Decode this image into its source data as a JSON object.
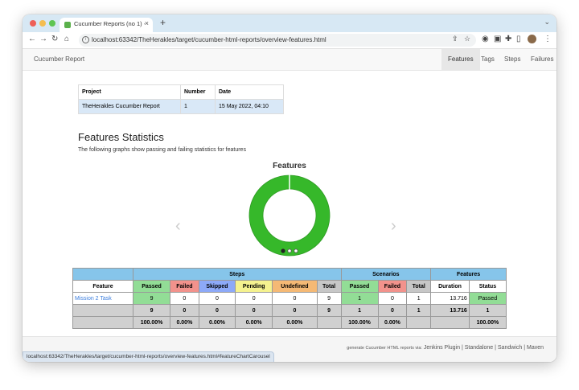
{
  "browser": {
    "tab_title": "Cucumber Reports (no 1) - Fea",
    "tab_close": "×",
    "new_tab": "+",
    "url": "localhost:63342/TheHerakles/target/cucumber-html-reports/overview-features.html",
    "status_url": "localhost:63342/TheHerakles/target/cucumber-html-reports/overview-features.html#featureChartCarousel"
  },
  "navbar": {
    "brand": "Cucumber Report",
    "links": [
      "Features",
      "Tags",
      "Steps",
      "Failures"
    ]
  },
  "report": {
    "headers": [
      "Project",
      "Number",
      "Date"
    ],
    "row": [
      "TheHerakles Cucumber Report",
      "1",
      "15 May 2022, 04:10"
    ]
  },
  "stats": {
    "title": "Features Statistics",
    "subtitle": "The following graphs show passing and failing statistics for features"
  },
  "chart_data": {
    "type": "pie",
    "title": "Features",
    "categories": [
      "Passed"
    ],
    "values": [
      1
    ],
    "colors": {
      "Passed": "#36b82a"
    }
  },
  "table": {
    "group_headers": [
      "Steps",
      "Scenarios",
      "Features"
    ],
    "feature_header": "Feature",
    "step_headers": [
      "Passed",
      "Failed",
      "Skipped",
      "Pending",
      "Undefined",
      "Total"
    ],
    "scenario_headers": [
      "Passed",
      "Failed",
      "Total"
    ],
    "feature_headers": [
      "Duration",
      "Status"
    ],
    "row": {
      "name": "Mission 2 Task",
      "steps": [
        "9",
        "0",
        "0",
        "0",
        "0",
        "9"
      ],
      "scenarios": [
        "1",
        "0",
        "1"
      ],
      "duration": "13.716",
      "status": "Passed"
    },
    "totals": {
      "steps": [
        "9",
        "0",
        "0",
        "0",
        "0",
        "9"
      ],
      "scenarios": [
        "1",
        "0",
        "1"
      ],
      "duration": "13.716",
      "status": "1"
    },
    "percents": {
      "steps": [
        "100.00%",
        "0.00%",
        "0.00%",
        "0.00%",
        "0.00%"
      ],
      "scenarios": [
        "100.00%",
        "0.00%"
      ],
      "status": "100.00%"
    }
  },
  "footer": {
    "prefix": "generate Cucumber HTML reports via:",
    "links": [
      "Jenkins Plugin",
      "Standalone",
      "Sandwich",
      "Maven"
    ],
    "sep": "|"
  }
}
